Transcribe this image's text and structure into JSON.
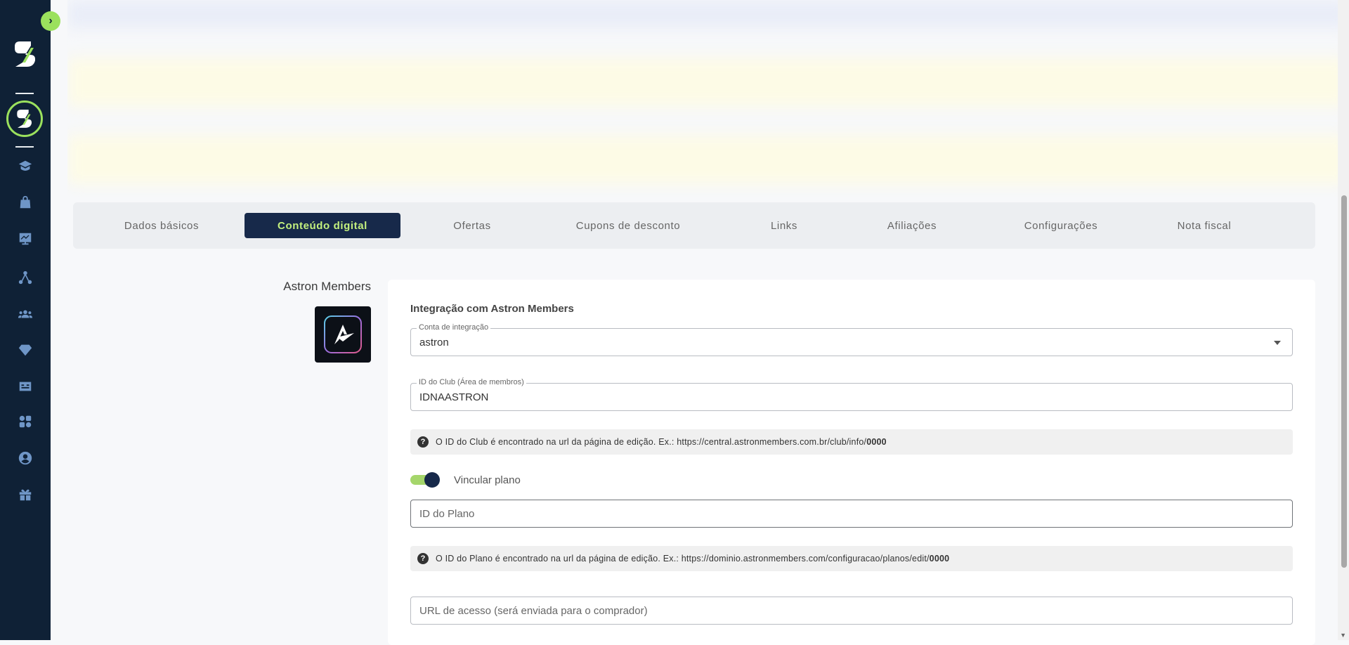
{
  "sidebar": {
    "toggle_glyph": "›",
    "nav_icons": [
      "school-icon",
      "shopping-bag-icon",
      "sales-chart-icon",
      "network-icon",
      "users-icon",
      "diamond-icon",
      "card-icon",
      "apps-icon",
      "account-icon",
      "gift-icon"
    ],
    "accent_color": "#9be15d",
    "background_color": "#0f2136"
  },
  "tabs": [
    {
      "label": "Dados básicos",
      "active": false
    },
    {
      "label": "Conteúdo digital",
      "active": true
    },
    {
      "label": "Ofertas",
      "active": false
    },
    {
      "label": "Cupons de desconto",
      "active": false
    },
    {
      "label": "Links",
      "active": false
    },
    {
      "label": "Afiliações",
      "active": false
    },
    {
      "label": "Configurações",
      "active": false
    },
    {
      "label": "Nota fiscal",
      "active": false
    }
  ],
  "integration": {
    "side_title": "Astron Members",
    "card_title": "Integração com Astron Members",
    "account_field": {
      "label": "Conta de integração",
      "value": "astron"
    },
    "club_field": {
      "label": "ID do Club (Área de membros)",
      "value": "IDNAASTRON"
    },
    "club_help": {
      "text": "O ID do Club é encontrado na url da página de edição. Ex.: https://central.astronmembers.com.br/club/info/",
      "bold": "0000"
    },
    "link_plan": {
      "label": "Vincular plano",
      "enabled": true
    },
    "plan_field": {
      "placeholder": "ID do Plano"
    },
    "plan_help": {
      "text": "O ID do Plano é encontrado na url da página de edição. Ex.: https://dominio.astronmembers.com/configuracao/planos/edit/",
      "bold": "0000"
    },
    "access_url_field": {
      "placeholder": "URL de acesso (será enviada para o comprador)"
    }
  },
  "colors": {
    "active_tab_bg": "#17294a",
    "active_tab_text": "#c4f07e"
  }
}
